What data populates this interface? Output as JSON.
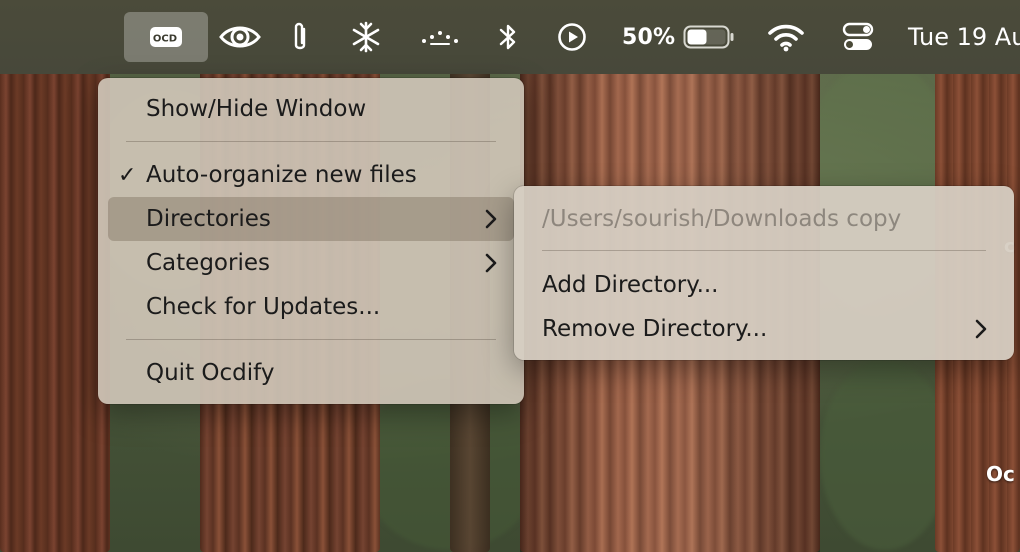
{
  "menubar": {
    "app_icon_text": "OCD",
    "battery_percent": "50%",
    "battery_level": 0.5,
    "clock": "Tue 19 Au",
    "icons": [
      "ocdify-icon",
      "eye-icon",
      "paperclip-icon",
      "snowflake-icon",
      "dots-icon",
      "bluetooth-icon",
      "play-icon",
      "battery-icon",
      "wifi-icon",
      "control-center-icon"
    ]
  },
  "main_menu": {
    "items": [
      {
        "label": "Show/Hide Window"
      },
      {
        "label": "Auto-organize new files",
        "checked": true
      },
      {
        "label": "Directories",
        "submenu": true,
        "highlighted": true
      },
      {
        "label": "Categories",
        "submenu": true
      },
      {
        "label": "Check for Updates..."
      },
      {
        "label": "Quit Ocdify"
      }
    ],
    "check_glyph": "✓"
  },
  "directories_submenu": {
    "items": [
      {
        "label": "/Users/sourish/Downloads copy",
        "disabled": true
      },
      {
        "label": "Add Directory..."
      },
      {
        "label": "Remove Directory...",
        "submenu": true
      }
    ]
  },
  "desktop": {
    "label_right": "Oc",
    "label_partial": "c"
  },
  "colors": {
    "menubar": "#4a4a38",
    "menu_bg": "#cdc4b6",
    "highlight": "#8c8070"
  }
}
